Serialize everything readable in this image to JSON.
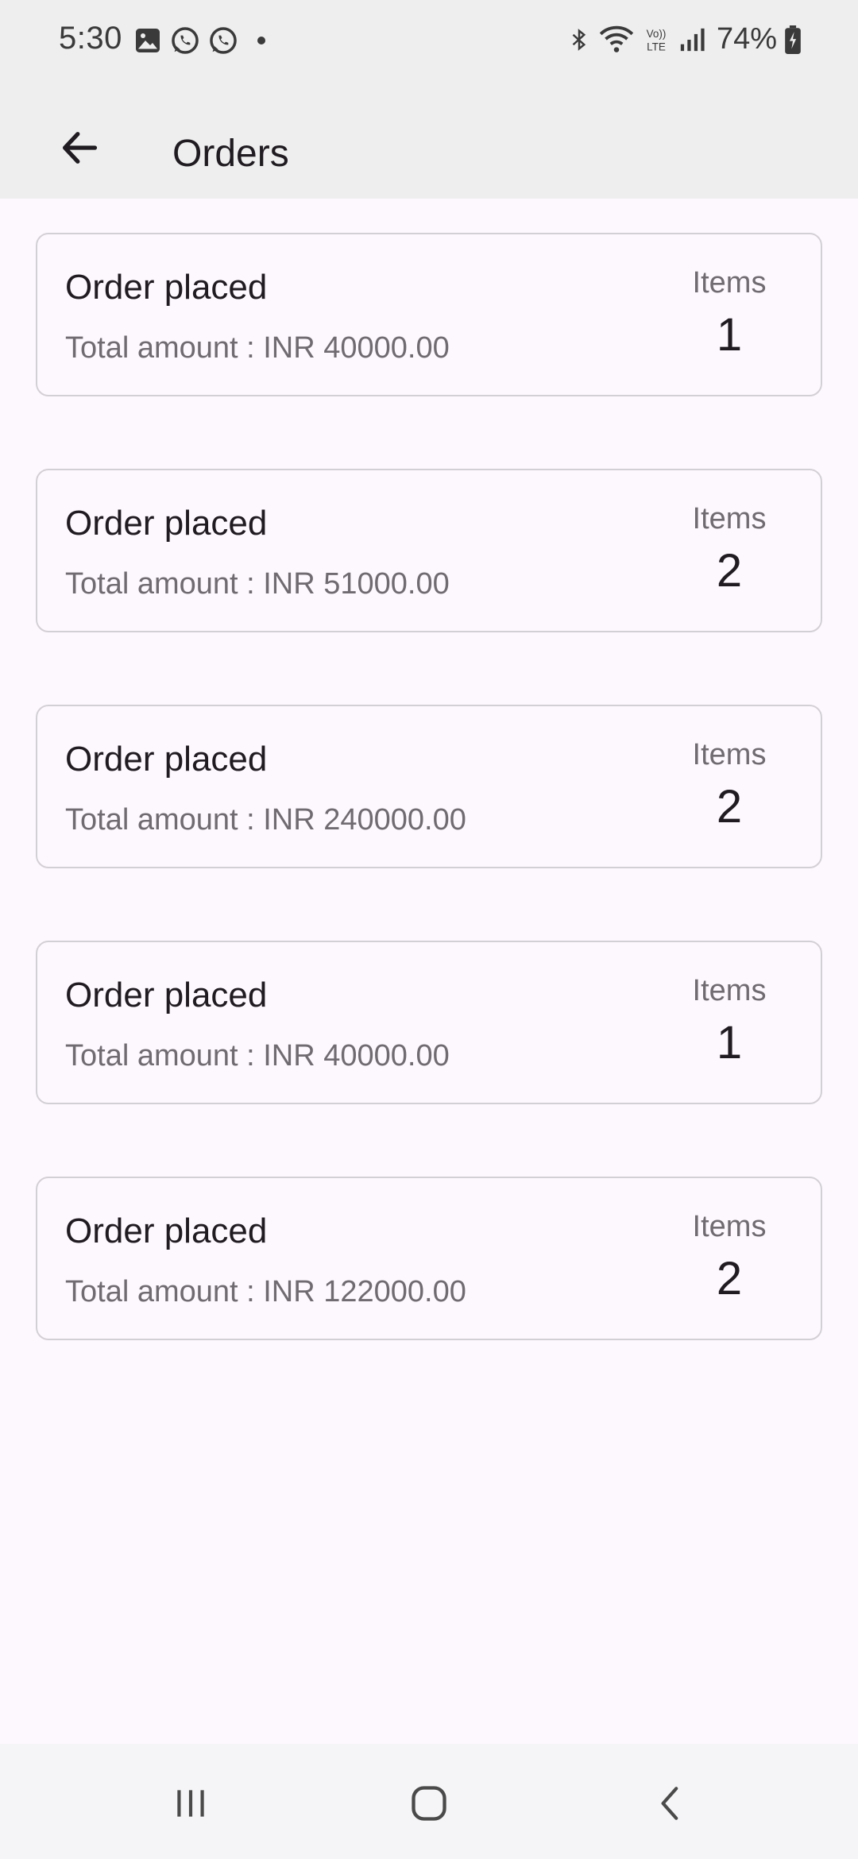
{
  "status_bar": {
    "time": "5:30",
    "left_icons": [
      "image-icon",
      "whatsapp-icon",
      "whatsapp-icon",
      "notification-dot-icon"
    ],
    "right_icons": [
      "bluetooth-icon",
      "wifi-icon",
      "volte-icon",
      "signal-icon",
      "battery-icon"
    ],
    "volte_label": "Vo)) LTE",
    "battery": "74%"
  },
  "app_bar": {
    "title": "Orders",
    "back_icon": "arrow-back-icon"
  },
  "orders": [
    {
      "status": "Order placed",
      "total": "Total amount : INR 40000.00",
      "items_label": "Items",
      "items_count": "1"
    },
    {
      "status": "Order placed",
      "total": "Total amount : INR 51000.00",
      "items_label": "Items",
      "items_count": "2"
    },
    {
      "status": "Order placed",
      "total": "Total amount : INR 240000.00",
      "items_label": "Items",
      "items_count": "2"
    },
    {
      "status": "Order placed",
      "total": "Total amount : INR 40000.00",
      "items_label": "Items",
      "items_count": "1"
    },
    {
      "status": "Order placed",
      "total": "Total amount : INR 122000.00",
      "items_label": "Items",
      "items_count": "2"
    }
  ],
  "nav_bar": {
    "buttons": [
      "recent-apps-icon",
      "home-icon",
      "back-icon"
    ]
  },
  "colors": {
    "background": "#fdf7fe",
    "bar": "#eeeeee",
    "card_border": "#d3d0d5",
    "primary_text": "#1f1b20",
    "secondary_text": "#6f6b70"
  }
}
